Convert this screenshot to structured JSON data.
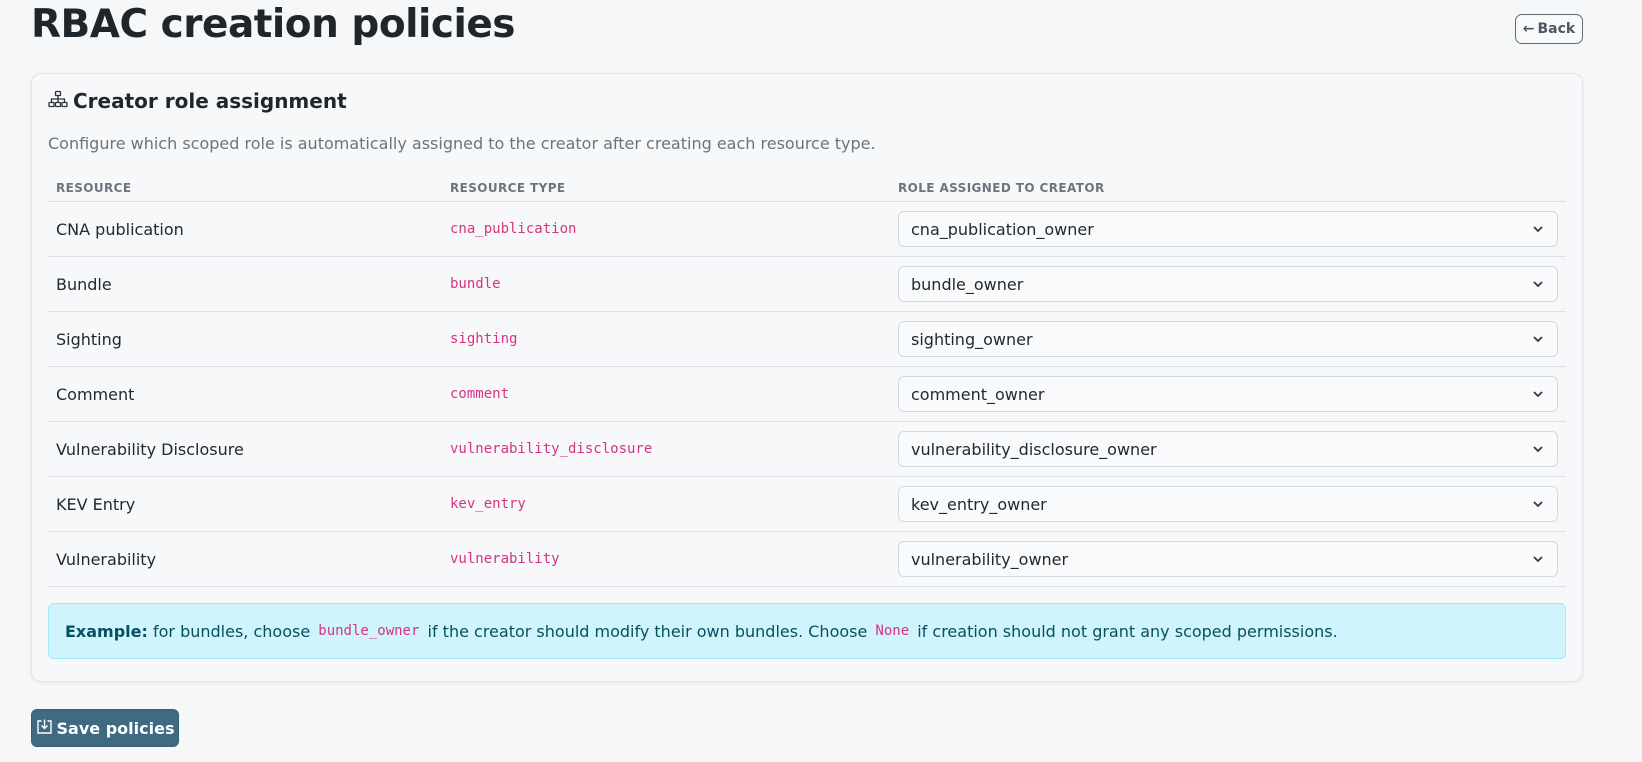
{
  "page": {
    "title": "RBAC creation policies"
  },
  "header": {
    "back_arrow": "←",
    "back_label": "Back"
  },
  "card": {
    "icon": "hierarchy-icon",
    "title": "Creator role assignment",
    "description": "Configure which scoped role is automatically assigned to the creator after creating each resource type."
  },
  "table": {
    "columns": [
      "RESOURCE",
      "RESOURCE TYPE",
      "ROLE ASSIGNED TO CREATOR"
    ],
    "rows": [
      {
        "resource": "CNA publication",
        "type": "cna_publication",
        "role": "cna_publication_owner"
      },
      {
        "resource": "Bundle",
        "type": "bundle",
        "role": "bundle_owner"
      },
      {
        "resource": "Sighting",
        "type": "sighting",
        "role": "sighting_owner"
      },
      {
        "resource": "Comment",
        "type": "comment",
        "role": "comment_owner"
      },
      {
        "resource": "Vulnerability Disclosure",
        "type": "vulnerability_disclosure",
        "role": "vulnerability_disclosure_owner"
      },
      {
        "resource": "KEV Entry",
        "type": "kev_entry",
        "role": "kev_entry_owner"
      },
      {
        "resource": "Vulnerability",
        "type": "vulnerability",
        "role": "vulnerability_owner"
      }
    ]
  },
  "info": {
    "label": "Example:",
    "text1": "for bundles, choose",
    "code1": "bundle_owner",
    "text2": "if the creator should modify their own bundles. Choose",
    "code2": "None",
    "text3": "if creation should not grant any scoped permissions."
  },
  "save": {
    "label": "Save policies",
    "icon": "download-icon"
  },
  "colors": {
    "background": "#f5f7f9",
    "code_pink": "#d63384",
    "info_bg": "#cff4fc",
    "info_text": "#055160",
    "primary_button": "#3f6a82"
  }
}
